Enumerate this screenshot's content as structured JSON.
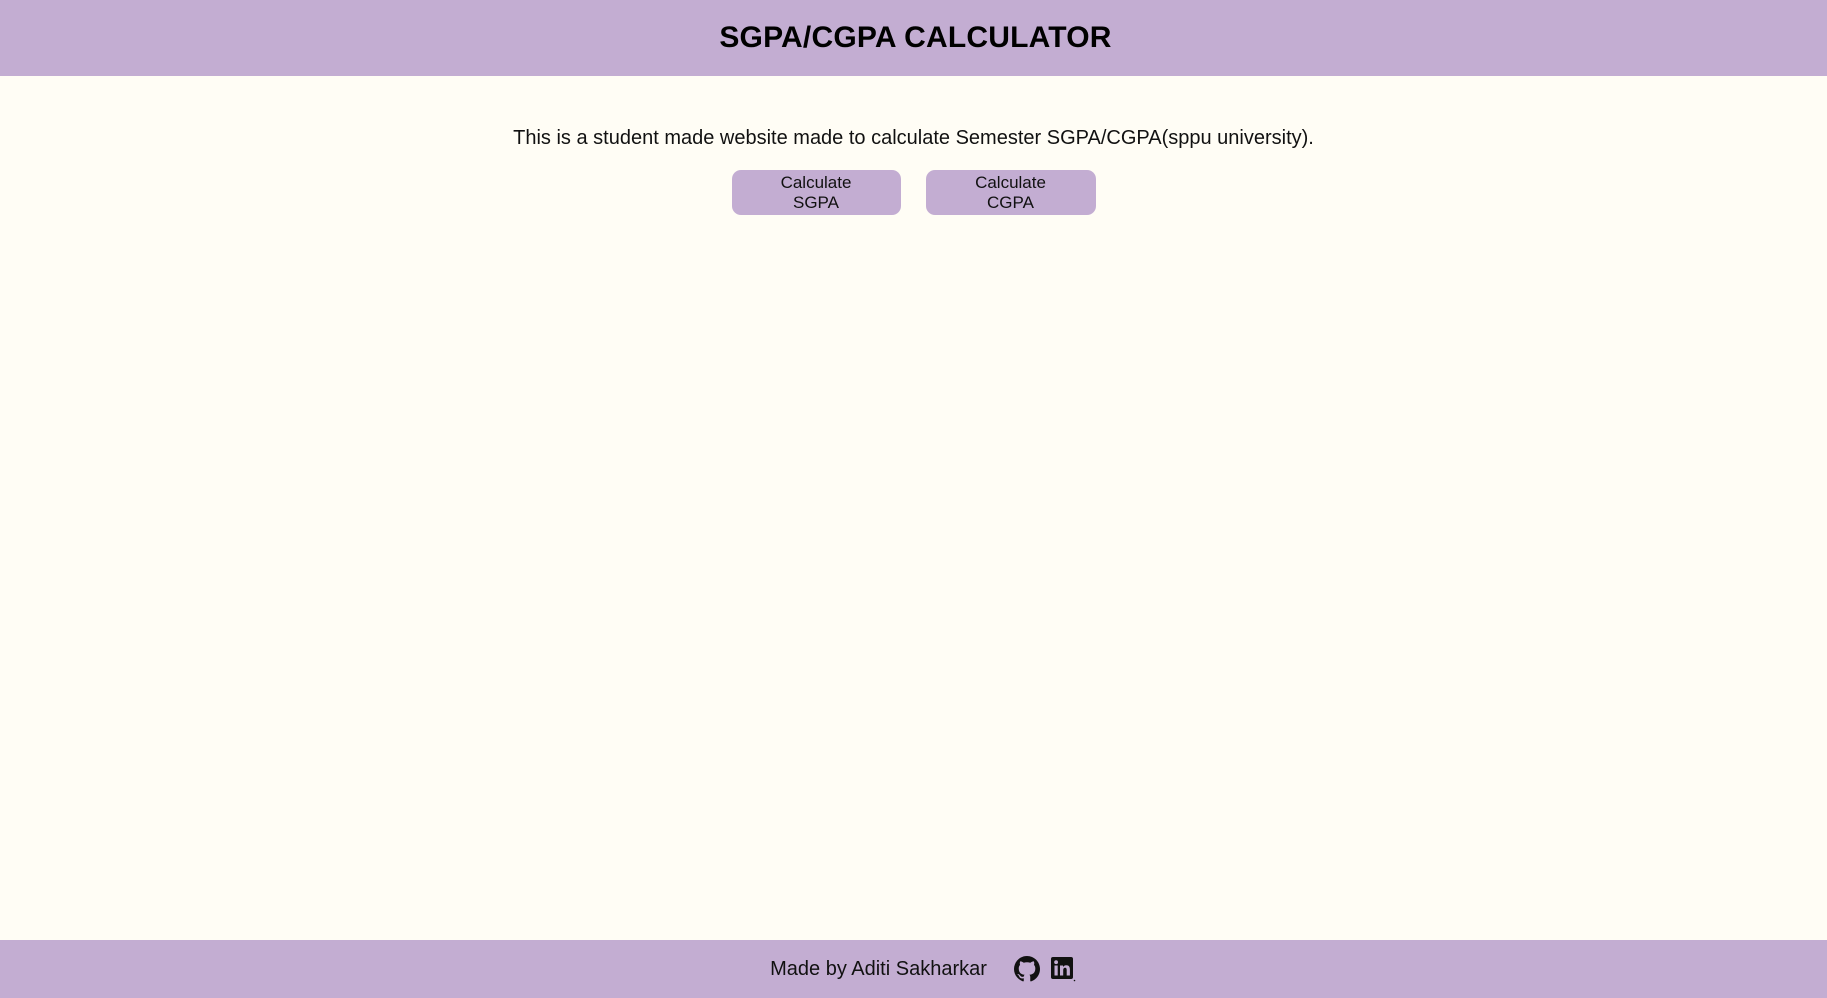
{
  "header": {
    "title": "SGPA/CGPA CALCULATOR"
  },
  "main": {
    "intro_text": "This is a student made website made to calculate Semester SGPA/CGPA(sppu university).",
    "buttons": {
      "sgpa_label": "Calculate SGPA",
      "cgpa_label": "Calculate CGPA"
    }
  },
  "footer": {
    "credit_text": "Made by Aditi Sakharkar",
    "icons": [
      "github-icon",
      "linkedin-icon"
    ]
  },
  "colors": {
    "accent": "#c3add2",
    "background": "#fffdf5",
    "text": "#111111"
  }
}
